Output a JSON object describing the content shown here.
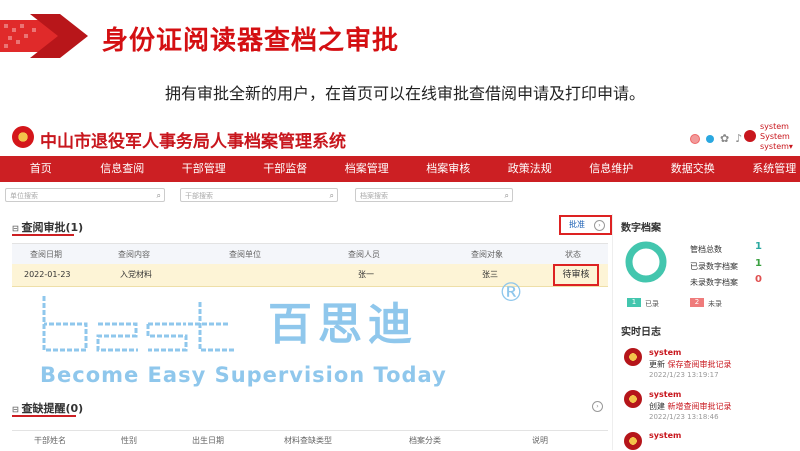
{
  "slide": {
    "title": "身份证阅读器查档之审批",
    "subtitle": "拥有审批全新的用户，在首页可以在线审批查借阅申请及打印申请。"
  },
  "app": {
    "name": "中山市退役军人事务局人事档案管理系统",
    "user_lines": [
      "system",
      "System",
      "system▾"
    ],
    "status_dots": [
      "#f29a9a",
      "#2aa8e0"
    ]
  },
  "nav": [
    "首页",
    "信息查阅",
    "干部管理",
    "干部监督",
    "档案管理",
    "档案审核",
    "政策法规",
    "信息维护",
    "数据交换",
    "系统管理"
  ],
  "search": [
    {
      "placeholder": "单位搜索"
    },
    {
      "placeholder": "干部搜索"
    },
    {
      "placeholder": "档案搜索"
    }
  ],
  "review": {
    "title": "查阅审批(1)",
    "approve_label": "批准",
    "columns": [
      "查阅日期",
      "查阅内容",
      "查阅单位",
      "查阅人员",
      "查阅对象",
      "状态"
    ],
    "row": {
      "date": "2022-01-23",
      "content": "入党材料",
      "unit": "",
      "person": "张一",
      "target": "张三",
      "status": "待审核"
    }
  },
  "missing": {
    "title": "查缺提醒(0)",
    "columns": [
      "干部姓名",
      "性别",
      "出生日期",
      "材料查缺类型",
      "档案分类",
      "说明"
    ]
  },
  "watermark": {
    "brand": "best",
    "cn": "百思迪",
    "reg": "®",
    "slogan": "Become Easy Supervision Today"
  },
  "digital": {
    "title": "数字档案",
    "stats": [
      {
        "label": "管档总数",
        "value": "1",
        "color": "#2aa8a0"
      },
      {
        "label": "已录数字档案",
        "value": "1",
        "color": "#3aa040"
      },
      {
        "label": "未录数字档案",
        "value": "0",
        "color": "#e05050"
      }
    ],
    "legend": [
      {
        "count": "1",
        "label": "已录",
        "color": "#43c6ae"
      },
      {
        "count": "2",
        "label": "未录",
        "color": "#ef7b7b"
      }
    ],
    "ring_fraction": 1.0
  },
  "log": {
    "title": "实时日志",
    "entries": [
      {
        "user": "system",
        "verb": "更新",
        "object": "保存查阅审批记录",
        "time": "2022/1/23 13:19:17"
      },
      {
        "user": "system",
        "verb": "创建",
        "object": "新增查阅审批记录",
        "time": "2022/1/23 13:18:46"
      },
      {
        "user": "system",
        "verb": "",
        "object": "",
        "time": ""
      }
    ]
  }
}
